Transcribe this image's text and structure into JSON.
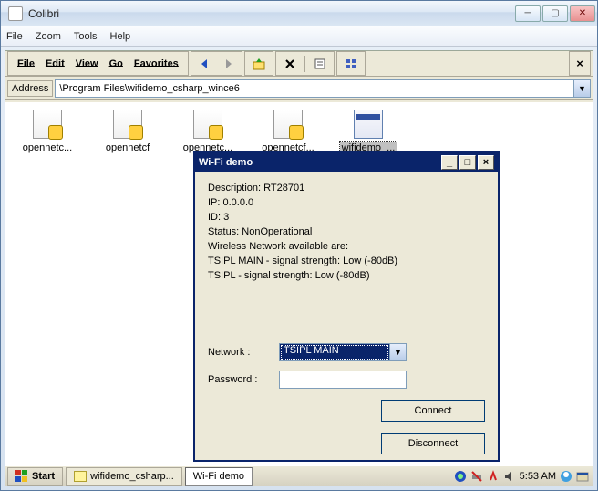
{
  "outer": {
    "title": "Colibri",
    "menu": {
      "file": "File",
      "zoom": "Zoom",
      "tools": "Tools",
      "help": "Help"
    }
  },
  "ce_menu": {
    "file": "File",
    "edit": "Edit",
    "view": "View",
    "go": "Go",
    "favorites": "Favorites"
  },
  "address": {
    "label": "Address",
    "value": "\\Program Files\\wifidemo_csharp_wince6"
  },
  "files": [
    {
      "label": "opennetc...",
      "type": "dll"
    },
    {
      "label": "opennetcf",
      "type": "dll"
    },
    {
      "label": "opennetc...",
      "type": "dll"
    },
    {
      "label": "opennetcf...",
      "type": "dll"
    },
    {
      "label": "wifidemo_...",
      "type": "exe",
      "selected": true
    }
  ],
  "wifi": {
    "title": "Wi-Fi demo",
    "info": {
      "description": "Description: RT28701",
      "ip": "IP: 0.0.0.0",
      "id": "ID: 3",
      "status": "Status: NonOperational",
      "avail_header": "Wireless Network available are:",
      "net1": "TSIPL MAIN -  signal strength: Low (-80dB)",
      "net2": "TSIPL -  signal strength: Low (-80dB)"
    },
    "labels": {
      "network": "Network  :",
      "password": "Password  :"
    },
    "network_value": "TSIPL MAIN",
    "password_value": "",
    "buttons": {
      "connect": "Connect",
      "disconnect": "Disconnect"
    }
  },
  "taskbar": {
    "start": "Start",
    "task1": "wifidemo_csharp...",
    "task2": "Wi-Fi demo",
    "clock": "5:53 AM"
  }
}
